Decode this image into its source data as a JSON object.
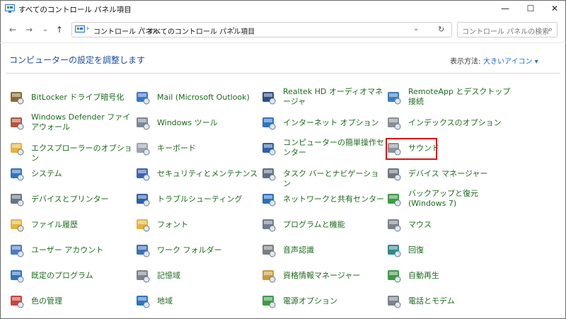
{
  "window": {
    "title": "すべてのコントロール パネル項目",
    "minimize_glyph": "—",
    "maximize_glyph": "☐",
    "close_glyph": "✕"
  },
  "nav": {
    "back_glyph": "←",
    "forward_glyph": "→",
    "recent_glyph": "⌄",
    "up_glyph": "↑",
    "breadcrumb": [
      "コントロール パネル",
      "すべてのコントロール パネル項目"
    ],
    "breadcrumb_sep": "›",
    "dropdown_glyph": "⌄",
    "refresh_glyph": "↻",
    "search_placeholder": "コントロール パネルの検索",
    "search_glyph": "⌕"
  },
  "header": {
    "title": "コンピューターの設定を調整します",
    "view_by_label": "表示方法:",
    "view_by_value": "大きいアイコン ▾"
  },
  "items": [
    {
      "label": "BitLocker ドライブ暗号化",
      "icon": "bitlocker-icon",
      "color": "#8a6b2f"
    },
    {
      "label": "Mail (Microsoft Outlook)",
      "icon": "mail-icon",
      "color": "#3b77c9"
    },
    {
      "label": "Realtek HD オーディオマネージャ",
      "icon": "realtek-audio-icon",
      "color": "#2c4f86"
    },
    {
      "label": "RemoteApp とデスクトップ接続",
      "icon": "remoteapp-icon",
      "color": "#3a7dbf"
    },
    {
      "label": "Windows Defender ファイアウォール",
      "icon": "firewall-icon",
      "color": "#b3553c"
    },
    {
      "label": "Windows ツール",
      "icon": "windows-tools-icon",
      "color": "#7b8794"
    },
    {
      "label": "インターネット オプション",
      "icon": "internet-options-icon",
      "color": "#2f74c0"
    },
    {
      "label": "インデックスのオプション",
      "icon": "indexing-icon",
      "color": "#8a8f96"
    },
    {
      "label": "エクスプローラーのオプション",
      "icon": "explorer-options-icon",
      "color": "#e6b33c"
    },
    {
      "label": "キーボード",
      "icon": "keyboard-icon",
      "color": "#9aa3ad"
    },
    {
      "label": "コンピューターの簡単操作センター",
      "icon": "ease-of-access-icon",
      "color": "#2f5fa8"
    },
    {
      "label": "サウンド",
      "icon": "sound-icon",
      "color": "#8d9399"
    },
    {
      "label": "システム",
      "icon": "system-icon",
      "color": "#2f74c0"
    },
    {
      "label": "セキュリティとメンテナンス",
      "icon": "security-flag-icon",
      "color": "#3b62b8"
    },
    {
      "label": "タスク バーとナビゲーション",
      "icon": "taskbar-icon",
      "color": "#5b6f86"
    },
    {
      "label": "デバイス マネージャー",
      "icon": "device-manager-icon",
      "color": "#6f7780"
    },
    {
      "label": "デバイスとプリンター",
      "icon": "printer-icon",
      "color": "#6a7480"
    },
    {
      "label": "トラブルシューティング",
      "icon": "troubleshoot-icon",
      "color": "#2f5fa8"
    },
    {
      "label": "ネットワークと共有センター",
      "icon": "network-icon",
      "color": "#2a6fc0"
    },
    {
      "label": "バックアップと復元 (Windows 7)",
      "icon": "backup-icon",
      "color": "#3e9b47"
    },
    {
      "label": "ファイル履歴",
      "icon": "file-history-icon",
      "color": "#e6b33c"
    },
    {
      "label": "フォント",
      "icon": "fonts-icon",
      "color": "#e6b33c"
    },
    {
      "label": "プログラムと機能",
      "icon": "programs-icon",
      "color": "#6f7d8c"
    },
    {
      "label": "マウス",
      "icon": "mouse-icon",
      "color": "#7a828c"
    },
    {
      "label": "ユーザー アカウント",
      "icon": "user-accounts-icon",
      "color": "#4a7cc4"
    },
    {
      "label": "ワーク フォルダー",
      "icon": "work-folders-icon",
      "color": "#3b6fb8"
    },
    {
      "label": "音声認識",
      "icon": "microphone-icon",
      "color": "#7a7f86"
    },
    {
      "label": "回復",
      "icon": "recovery-icon",
      "color": "#2f8a8a"
    },
    {
      "label": "既定のプログラム",
      "icon": "default-programs-icon",
      "color": "#2f74c0"
    },
    {
      "label": "記憶域",
      "icon": "storage-spaces-icon",
      "color": "#7b848e"
    },
    {
      "label": "資格情報マネージャー",
      "icon": "credential-manager-icon",
      "color": "#c99a3a"
    },
    {
      "label": "自動再生",
      "icon": "autoplay-icon",
      "color": "#3e9b47"
    },
    {
      "label": "色の管理",
      "icon": "color-management-icon",
      "color": "#c8443a"
    },
    {
      "label": "地域",
      "icon": "region-icon",
      "color": "#2f74c0"
    },
    {
      "label": "電源オプション",
      "icon": "power-options-icon",
      "color": "#3e9b47"
    },
    {
      "label": "電話とモデム",
      "icon": "phone-modem-icon",
      "color": "#7a828c"
    }
  ]
}
